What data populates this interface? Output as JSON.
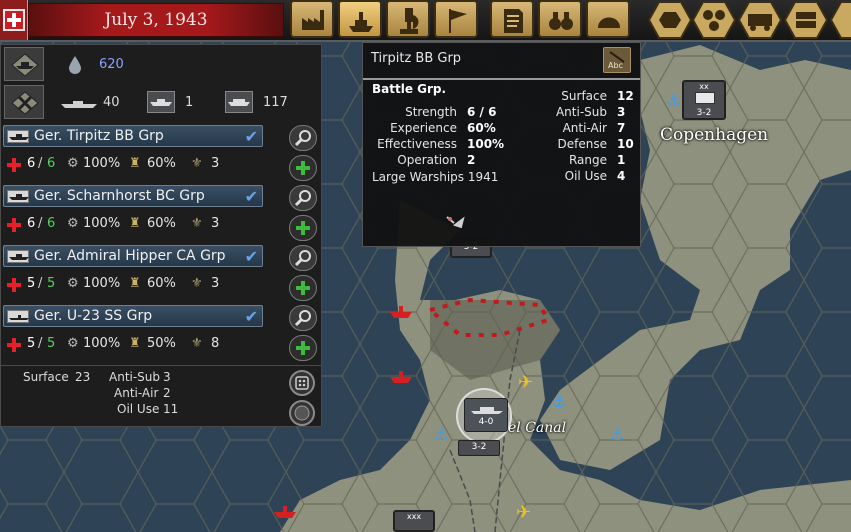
{
  "topbar": {
    "date": "July 3, 1943",
    "buttons": [
      "production-button",
      "navy-button",
      "research-button",
      "diplomacy-button",
      "decisions-button",
      "intelligence-button",
      "army-button",
      "map-mode-hex",
      "map-mode-resources",
      "map-mode-railways",
      "map-mode-supply",
      "map-mode-other"
    ]
  },
  "summary": {
    "fuel": "620",
    "ships_count": "40",
    "battle_groups": "1",
    "transports": "117"
  },
  "ships": [
    {
      "name": "Ger. Tirpitz BB Grp",
      "strength": "6",
      "max": "6",
      "supply": "100%",
      "org": "60%",
      "exp": "3"
    },
    {
      "name": "Ger. Scharnhorst BC Grp",
      "strength": "6",
      "max": "6",
      "supply": "100%",
      "org": "60%",
      "exp": "3"
    },
    {
      "name": "Ger. Admiral Hipper CA Grp",
      "strength": "5",
      "max": "5",
      "supply": "100%",
      "org": "60%",
      "exp": "3"
    },
    {
      "name": "Ger. U-23 SS Grp",
      "strength": "5",
      "max": "5",
      "supply": "100%",
      "org": "50%",
      "exp": "8"
    }
  ],
  "totals": {
    "surface_label": "Surface",
    "surface": "23",
    "antisub_label": "Anti-Sub",
    "antisub": "3",
    "antiair_label": "Anti-Air",
    "antiair": "2",
    "oil_label": "Oil Use",
    "oil": "11"
  },
  "tooltip": {
    "title": "Tirpitz BB Grp",
    "button": "Abc",
    "type": "Battle Grp.",
    "strength_label": "Strength",
    "strength": "6",
    "strength_max": "6",
    "experience_label": "Experience",
    "experience": "60%",
    "effectiveness_label": "Effectiveness",
    "effectiveness": "100%",
    "operation_label": "Operation",
    "operation": "2",
    "tech_label": "Large Warships 1941",
    "surface_label": "Surface",
    "surface": "12",
    "antisub_label": "Anti-Sub",
    "antisub": "3",
    "antiair_label": "Anti-Air",
    "antiair": "7",
    "defense_label": "Defense",
    "defense": "10",
    "range_label": "Range",
    "range": "1",
    "oil_label": "Oil Use",
    "oil": "4"
  },
  "map": {
    "city_label": "Copenhagen",
    "canal_label": "el Canal",
    "unit_counters": [
      {
        "top": "xx",
        "bottom": "3-2"
      },
      {
        "top": "",
        "bottom": "3-2"
      },
      {
        "top": "",
        "bottom": "4-0"
      },
      {
        "top": "",
        "bottom": "3-2"
      },
      {
        "top": "xxx",
        "bottom": ""
      }
    ]
  },
  "colors": {
    "sea": "#2e4356",
    "land": "#8f917f",
    "land_dark": "#6e7062",
    "accent_red": "#a5191b",
    "gold": "#d8b878"
  }
}
